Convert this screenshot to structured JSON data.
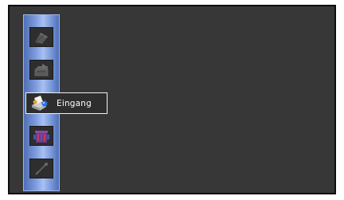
{
  "menu": {
    "items": [
      {
        "icon": "pencil-paper-icon",
        "selected": false
      },
      {
        "icon": "outbox-tray-icon",
        "selected": false
      },
      {
        "icon": "inbox-icon",
        "label": "Eingang",
        "selected": true
      },
      {
        "icon": "spam-bin-icon",
        "selected": false
      },
      {
        "icon": "tools-icon",
        "selected": false
      }
    ]
  },
  "colors": {
    "panel_bg": "#373737",
    "sidebar_blue": "#7f9ee0",
    "tile_bg": "#2e2e2e",
    "highlight_border": "#f0f0f0",
    "label_text": "#ffffff"
  }
}
